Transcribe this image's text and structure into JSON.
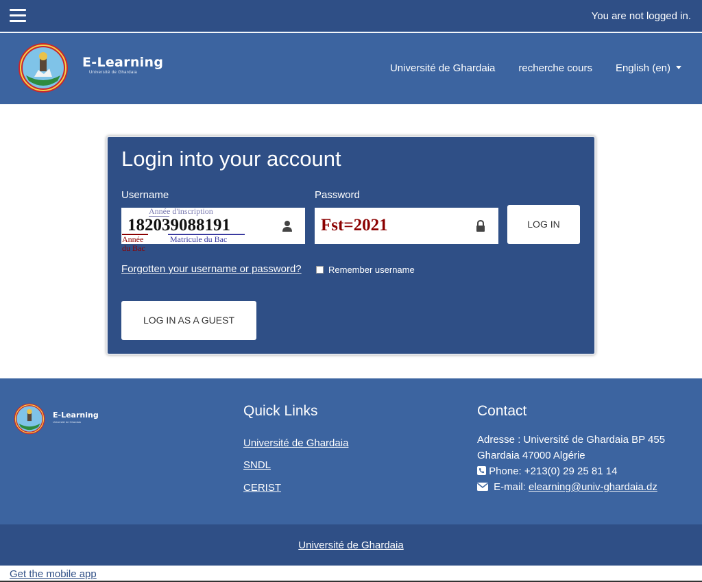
{
  "header": {
    "login_status": "You are not logged in."
  },
  "navbar": {
    "brand_title": "E-Learning",
    "brand_subtitle": "Université de Ghardaia",
    "links": [
      "Université de Ghardaia",
      "recherche cours",
      "English (en)"
    ]
  },
  "login": {
    "heading": "Login into your account",
    "username_label": "Username",
    "username_value": "182039088191",
    "password_label": "Password",
    "password_value": "Fst=2021",
    "login_button": "LOG IN",
    "forgot_link": "Forgotten your username or password?",
    "remember_label": "Remember username",
    "guest_button": "LOG IN AS A GUEST",
    "annotations": {
      "inscription": "Année d'inscription",
      "bac_year_line1": "Année",
      "bac_year_line2": "du Bac",
      "matricule": "Matricule du Bac"
    }
  },
  "footer": {
    "brand_title": "E-Learning",
    "brand_subtitle": "Université de Ghardaia",
    "quick_links_title": "Quick Links",
    "quick_links": [
      "Université de Ghardaia",
      "SNDL",
      "CERIST"
    ],
    "contact_title": "Contact",
    "address_line1": "Adresse : Université de Ghardaia BP 455",
    "address_line2": "Ghardaia 47000 Algérie",
    "phone": "Phone: +213(0) 29 25 81 14",
    "email_label": "E-mail:",
    "email": "elearning@univ-ghardaia.dz",
    "bottom_link": "Université de Ghardaia",
    "mobile_app": "Get the mobile app"
  },
  "colors": {
    "dark_blue": "#2f4f86",
    "mid_blue": "#3c64a0",
    "annotation_red": "#8b0000",
    "annotation_blue": "#3a3aa0"
  }
}
